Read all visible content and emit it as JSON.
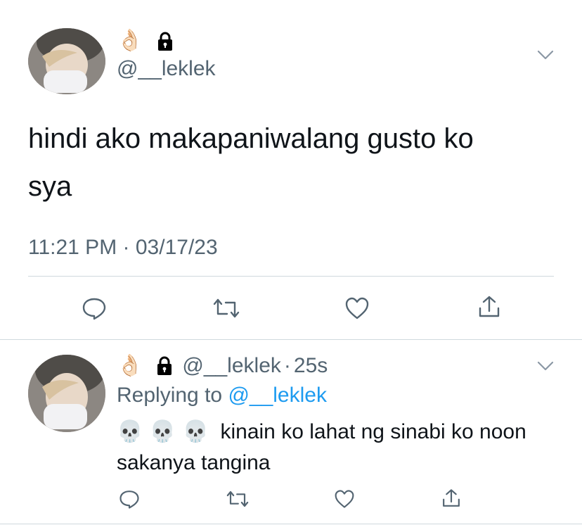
{
  "main_tweet": {
    "name_emoji": "👌🏻",
    "lock_icon": "lock-icon",
    "handle": "@__leklek",
    "text_line1": "hindi ako makapaniwalang gusto ko",
    "text_line2": "sya",
    "time": "11:21 PM",
    "sep": "·",
    "date": "03/17/23",
    "actions": [
      "reply-icon",
      "retweet-icon",
      "like-icon",
      "share-icon"
    ]
  },
  "reply_tweet": {
    "name_emoji": "👌🏻",
    "lock_icon": "lock-icon",
    "handle": "@__leklek",
    "sep": "·",
    "age": "25s",
    "replying_prefix": "Replying to",
    "replying_handle": "@__leklek",
    "skulls": "💀 💀 💀",
    "text_line1": "kinain ko lahat ng sinabi ko noon",
    "text_line2": "sakanya tangina",
    "actions": [
      "reply-icon",
      "retweet-icon",
      "like-icon",
      "share-icon"
    ]
  },
  "colors": {
    "text": "#0f1419",
    "secondary": "#536471",
    "link": "#1d9bf0",
    "divider": "#cfd9de"
  }
}
